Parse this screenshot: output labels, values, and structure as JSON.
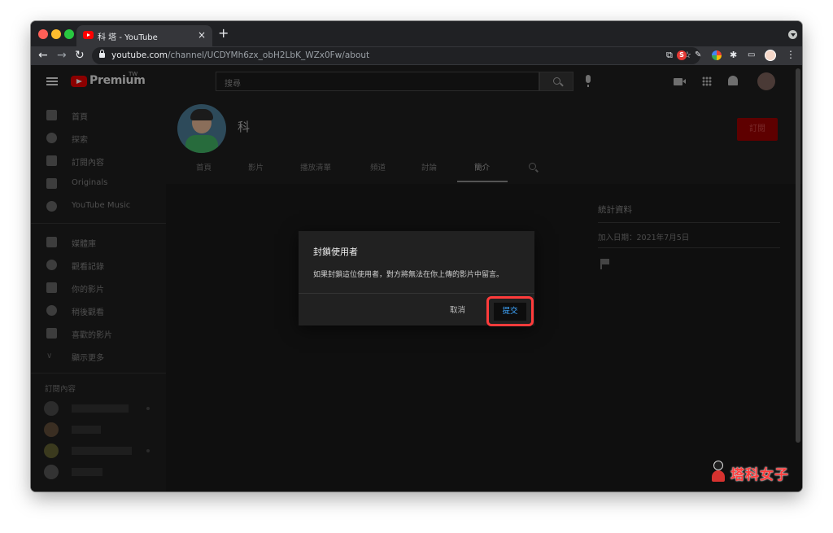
{
  "browser": {
    "tab_title": "科 塔 - YouTube",
    "tab_close": "×",
    "new_tab": "+",
    "url_host": "youtube.com",
    "url_path": "/channel/UCDYMh6zx_obH2LbK_WZx0Fw/about",
    "ext_s_label": "S",
    "back_icon": "←",
    "forward_icon": "→",
    "reload_icon": "↻",
    "star_icon": "☆",
    "share_icon": "⧉",
    "tool_icon": "✎",
    "puzzle_icon": "✱",
    "cast_icon": "▭",
    "menu_icon": "⋮"
  },
  "header": {
    "brand": "Premium",
    "region": "TW",
    "search_placeholder": "搜尋"
  },
  "sidebar": {
    "items": [
      {
        "label": "首頁",
        "icon": "home-icon"
      },
      {
        "label": "探索",
        "icon": "explore-icon"
      },
      {
        "label": "訂閱內容",
        "icon": "subscriptions-icon"
      },
      {
        "label": "Originals",
        "icon": "originals-icon"
      },
      {
        "label": "YouTube Music",
        "icon": "music-icon"
      }
    ],
    "library_items": [
      {
        "label": "媒體庫",
        "icon": "library-icon"
      },
      {
        "label": "觀看記錄",
        "icon": "history-icon"
      },
      {
        "label": "你的影片",
        "icon": "your-videos-icon"
      },
      {
        "label": "稍後觀看",
        "icon": "watch-later-icon"
      },
      {
        "label": "喜歡的影片",
        "icon": "liked-icon"
      },
      {
        "label": "顯示更多",
        "icon": "chevron-down-icon"
      }
    ],
    "subscriptions_heading": "訂閱內容"
  },
  "channel": {
    "name": "科",
    "subscribe_label": "訂閱",
    "tabs": [
      "首頁",
      "影片",
      "播放清單",
      "頻道",
      "討論",
      "簡介"
    ],
    "active_tab": "簡介"
  },
  "about": {
    "stats_title": "統計資料",
    "joined": "加入日期：2021年7月5日"
  },
  "dialog": {
    "title": "封鎖使用者",
    "message": "如果封鎖這位使用者，對方將無法在你上傳的影片中留言。",
    "cancel_label": "取消",
    "submit_label": "提交"
  },
  "watermark": {
    "text": "塔科女子"
  },
  "colors": {
    "highlight": "#ff3b3b",
    "link_blue": "#3ea6ff",
    "youtube_red": "#ff0000"
  }
}
